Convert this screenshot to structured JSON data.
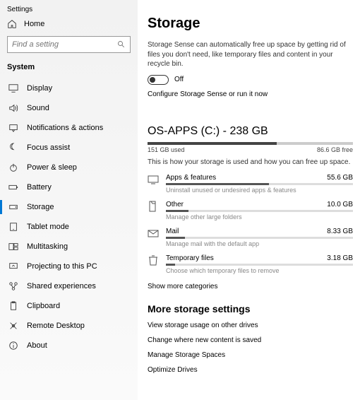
{
  "sidebar": {
    "title": "Settings",
    "home": "Home",
    "search_placeholder": "Find a setting",
    "section": "System",
    "items": [
      {
        "icon": "display",
        "label": "Display"
      },
      {
        "icon": "sound",
        "label": "Sound"
      },
      {
        "icon": "notify",
        "label": "Notifications & actions"
      },
      {
        "icon": "focus",
        "label": "Focus assist"
      },
      {
        "icon": "power",
        "label": "Power & sleep"
      },
      {
        "icon": "battery",
        "label": "Battery"
      },
      {
        "icon": "storage",
        "label": "Storage",
        "selected": true
      },
      {
        "icon": "tablet",
        "label": "Tablet mode"
      },
      {
        "icon": "multi",
        "label": "Multitasking"
      },
      {
        "icon": "project",
        "label": "Projecting to this PC"
      },
      {
        "icon": "shared",
        "label": "Shared experiences"
      },
      {
        "icon": "clip",
        "label": "Clipboard"
      },
      {
        "icon": "remote",
        "label": "Remote Desktop"
      },
      {
        "icon": "about",
        "label": "About"
      }
    ]
  },
  "main": {
    "title": "Storage",
    "sense_desc": "Storage Sense can automatically free up space by getting rid of files you don't need, like temporary files and content in your recycle bin.",
    "toggle_state": "Off",
    "configure_link": "Configure Storage Sense or run it now",
    "drive_title": "OS-APPS (C:) - 238 GB",
    "used_label": "151 GB used",
    "free_label": "86.6 GB free",
    "used_pct": 63,
    "usage_desc": "This is how your storage is used and how you can free up space.",
    "categories": [
      {
        "icon": "apps",
        "name": "Apps & features",
        "size": "55.6 GB",
        "pct": 55,
        "sub": "Uninstall unused or undesired apps & features"
      },
      {
        "icon": "other",
        "name": "Other",
        "size": "10.0 GB",
        "pct": 12,
        "sub": "Manage other large folders"
      },
      {
        "icon": "mail",
        "name": "Mail",
        "size": "8.33 GB",
        "pct": 10,
        "sub": "Manage mail with the default app"
      },
      {
        "icon": "temp",
        "name": "Temporary files",
        "size": "3.18 GB",
        "pct": 5,
        "sub": "Choose which temporary files to remove"
      }
    ],
    "show_more": "Show more categories",
    "more_hdr": "More storage settings",
    "more_links": [
      "View storage usage on other drives",
      "Change where new content is saved",
      "Manage Storage Spaces",
      "Optimize Drives"
    ]
  }
}
